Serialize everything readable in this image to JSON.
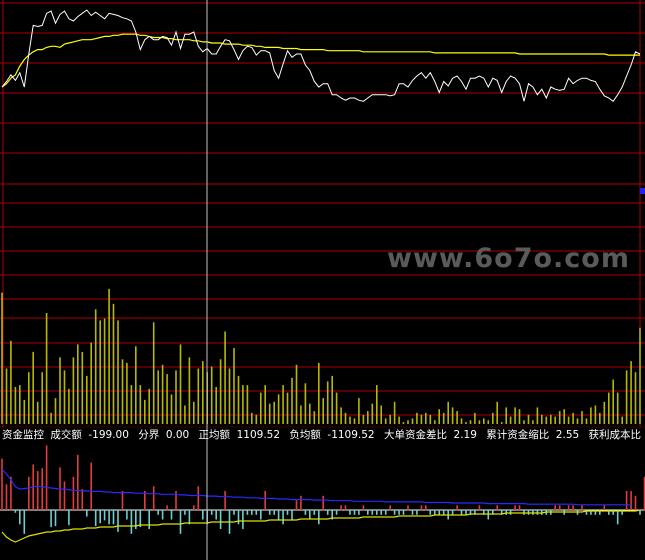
{
  "colors": {
    "background": "#000000",
    "grid": "#b00000",
    "price_line": "#ffffff",
    "avg_line": "#ffff00",
    "volume_bar": "#b8b800",
    "pos_bar": "#e23c3c",
    "neg_bar": "#6ecfcf",
    "fund_line": "#2a2aff",
    "fund_avg": "#e0e000",
    "cursor": "#c0c0c0",
    "accent": "#2020ff"
  },
  "watermark": "www.6o7o.com",
  "status": {
    "title": "资金监控",
    "items": [
      {
        "label": "成交额",
        "value": "-199.00"
      },
      {
        "label": "分界",
        "value": "0.00"
      },
      {
        "label": "正均额",
        "value": "1109.52"
      },
      {
        "label": "负均额",
        "value": "-1109.52"
      },
      {
        "label": "大单资金差比",
        "value": "2.19"
      },
      {
        "label": "累计资金缩比",
        "value": "2.55"
      },
      {
        "label": "获利成本比",
        "value": "-"
      }
    ]
  },
  "chart_data": {
    "type": "line",
    "title": "",
    "xlabel": "",
    "ylabel": "",
    "grid": true,
    "series": [
      {
        "values": [
          30,
          35,
          41,
          36,
          43,
          30,
          60,
          86,
          85,
          86,
          97,
          99,
          88,
          96,
          99,
          92,
          90,
          94,
          97,
          100,
          95,
          98,
          95,
          92,
          97,
          96,
          95,
          93,
          92,
          90,
          80,
          64,
          73,
          76,
          73,
          73,
          76,
          75,
          68,
          80,
          65,
          78,
          78,
          80,
          67,
          62,
          65,
          60,
          60,
          67,
          73,
          72,
          64,
          55,
          63,
          67,
          66,
          59,
          63,
          63,
          61,
          45,
          38,
          51,
          63,
          57,
          60,
          60,
          50,
          45,
          35,
          30,
          33,
          33,
          23,
          23,
          20,
          18,
          20,
          20,
          18,
          17,
          20,
          23,
          23,
          23,
          23,
          22,
          23,
          33,
          33,
          30,
          36,
          40,
          43,
          38,
          43,
          35,
          25,
          35,
          31,
          38,
          40,
          35,
          28,
          38,
          38,
          40,
          38,
          30,
          38,
          36,
          25,
          35,
          40,
          38,
          33,
          17,
          33,
          30,
          23,
          28,
          20,
          30,
          28,
          27,
          28,
          38,
          33,
          36,
          38,
          38,
          36,
          35,
          28,
          22,
          20,
          17,
          23,
          30,
          40,
          50,
          62,
          60
        ]
      },
      {
        "values": [
          30,
          33,
          38,
          41,
          49,
          55,
          59,
          62,
          64,
          64,
          66,
          67,
          67,
          66,
          69,
          70,
          71,
          72,
          73,
          73,
          73,
          74,
          75,
          76,
          76,
          77,
          77,
          78,
          78,
          78,
          78,
          77,
          77,
          76,
          75,
          75,
          75,
          74,
          74,
          73,
          73,
          73,
          73,
          72,
          72,
          71,
          71,
          70,
          70,
          70,
          69,
          69,
          69,
          69,
          68,
          68,
          68,
          67,
          67,
          66,
          66,
          66,
          66,
          65,
          65,
          65,
          65,
          64,
          64,
          64,
          64,
          64,
          64,
          63,
          63,
          63,
          63,
          63,
          63,
          63,
          63,
          62,
          62,
          62,
          62,
          62,
          62,
          62,
          62,
          62,
          62,
          62,
          62,
          62,
          62,
          62,
          62,
          61,
          61,
          61,
          61,
          61,
          61,
          61,
          61,
          61,
          61,
          61,
          61,
          61,
          61,
          61,
          61,
          61,
          61,
          61,
          60,
          60,
          60,
          60,
          60,
          60,
          60,
          60,
          60,
          60,
          60,
          60,
          60,
          60,
          60,
          60,
          60,
          60,
          60,
          60,
          59,
          59,
          59,
          59,
          59,
          59,
          59,
          59
        ]
      }
    ],
    "volume": [
      71,
      30,
      45,
      20,
      21,
      13,
      28,
      39,
      12,
      28,
      60,
      6,
      14,
      36,
      29,
      19,
      36,
      43,
      39,
      26,
      44,
      62,
      56,
      57,
      73,
      65,
      56,
      35,
      33,
      21,
      42,
      21,
      13,
      19,
      55,
      29,
      32,
      27,
      16,
      29,
      43,
      10,
      36,
      12,
      30,
      34,
      28,
      31,
      20,
      35,
      50,
      30,
      41,
      26,
      21,
      21,
      6,
      5,
      17,
      21,
      11,
      12,
      16,
      21,
      17,
      25,
      32,
      10,
      22,
      11,
      7,
      33,
      14,
      23,
      26,
      17,
      9,
      6,
      4,
      3,
      14,
      5,
      7,
      11,
      21,
      10,
      3,
      5,
      12,
      4,
      1,
      2,
      3,
      6,
      5,
      6,
      5,
      2,
      8,
      6,
      12,
      9,
      7,
      3,
      1,
      2,
      6,
      2,
      3,
      2,
      6,
      12,
      1,
      9,
      4,
      9,
      8,
      2,
      5,
      2,
      9,
      5,
      4,
      5,
      4,
      7,
      8,
      4,
      6,
      3,
      7,
      3,
      9,
      10,
      6,
      12,
      17,
      24,
      17,
      4,
      29,
      34,
      28,
      52
    ],
    "fund_flow": [
      54,
      27,
      35,
      -3,
      -15,
      -25,
      35,
      48,
      41,
      44,
      68,
      -18,
      -17,
      45,
      30,
      -16,
      35,
      58,
      22,
      -7,
      50,
      -17,
      -14,
      -11,
      -15,
      -15,
      -23,
      20,
      -10,
      -25,
      -20,
      -18,
      20,
      -20,
      25,
      -5,
      -10,
      5,
      -10,
      20,
      -25,
      -5,
      -15,
      5,
      25,
      -10,
      -15,
      -5,
      -10,
      -20,
      20,
      -25,
      -5,
      -15,
      -20,
      -5,
      -5,
      -5,
      -10,
      20,
      -5,
      -5,
      -10,
      -15,
      -5,
      -10,
      10,
      15,
      -5,
      -10,
      -5,
      -15,
      15,
      -5,
      -10,
      -5,
      5,
      5,
      -5,
      -5,
      -5,
      5,
      -5,
      -5,
      -5,
      -5,
      -5,
      5,
      -5,
      -5,
      -5,
      5,
      -5,
      -5,
      5,
      5,
      -5,
      -5,
      -5,
      -5,
      -10,
      -5,
      5,
      -5,
      -5,
      -5,
      -5,
      5,
      -5,
      -10,
      -5,
      5,
      -5,
      -5,
      -5,
      5,
      5,
      -5,
      -5,
      -5,
      -5,
      -5,
      -5,
      -5,
      5,
      5,
      -5,
      5,
      5,
      -5,
      5,
      -5,
      -5,
      -5,
      -5,
      5,
      -5,
      -5,
      -15,
      -5,
      20,
      20,
      15,
      -5,
      35,
      40
    ],
    "fund_cum": [
      70,
      62,
      52,
      40,
      36,
      37,
      38,
      40,
      41,
      40,
      39,
      38,
      37,
      36,
      36,
      35,
      34,
      34,
      33,
      33,
      32,
      32,
      32,
      31,
      31,
      30,
      30,
      30,
      30,
      30,
      29,
      29,
      29,
      28,
      28,
      28,
      27,
      27,
      27,
      27,
      26,
      26,
      25,
      25,
      25,
      25,
      24,
      24,
      24,
      23,
      23,
      23,
      22,
      22,
      22,
      21,
      21,
      21,
      20,
      20,
      20,
      20,
      19,
      19,
      19,
      18,
      18,
      18,
      18,
      18,
      17,
      17,
      17,
      17,
      16,
      16,
      16,
      16,
      16,
      15,
      15,
      15,
      15,
      15,
      15,
      15,
      14,
      14,
      14,
      14,
      14,
      14,
      14,
      14,
      14,
      13,
      13,
      13,
      13,
      13,
      13,
      12,
      12,
      12,
      12,
      12,
      12,
      12,
      12,
      11,
      11,
      11,
      11,
      11,
      11,
      11,
      11,
      11,
      10,
      10,
      10,
      10,
      10,
      10,
      10,
      10,
      10,
      10,
      10,
      9,
      9,
      9,
      9,
      9,
      9,
      9,
      9,
      9,
      9,
      9,
      9,
      9
    ],
    "fund_avg": [
      -22,
      -27,
      -30,
      -32,
      -30,
      -28,
      -26,
      -25,
      -24,
      -23,
      -22,
      -22,
      -21,
      -21,
      -20,
      -20,
      -19,
      -19,
      -19,
      -18,
      -18,
      -18,
      -17,
      -17,
      -17,
      -17,
      -16,
      -16,
      -16,
      -16,
      -16,
      -15,
      -15,
      -15,
      -15,
      -15,
      -14,
      -14,
      -14,
      -14,
      -14,
      -13,
      -13,
      -13,
      -13,
      -13,
      -13,
      -12,
      -12,
      -12,
      -12,
      -12,
      -12,
      -11,
      -11,
      -11,
      -11,
      -11,
      -11,
      -11,
      -10,
      -10,
      -10,
      -10,
      -10,
      -10,
      -10,
      -9,
      -9,
      -9,
      -9,
      -9,
      -9,
      -9,
      -8,
      -8,
      -8,
      -8,
      -8,
      -8,
      -8,
      -7,
      -7,
      -7,
      -7,
      -7,
      -7,
      -7,
      -7,
      -6,
      -6,
      -6,
      -6,
      -6,
      -6,
      -6,
      -6,
      -5,
      -5,
      -5,
      -5,
      -5,
      -5,
      -5,
      -5,
      -4,
      -4,
      -4,
      -4,
      -4,
      -4,
      -4,
      -4,
      -3,
      -3,
      -3,
      -3,
      -3,
      -3,
      -3,
      -3,
      -3,
      -2,
      -2,
      -2,
      -2,
      -2,
      -2,
      -2,
      -2,
      -2,
      -1,
      -1,
      -1,
      -1,
      -1,
      -1,
      -1,
      -1,
      -1,
      -1,
      -1,
      -1,
      0
    ]
  }
}
